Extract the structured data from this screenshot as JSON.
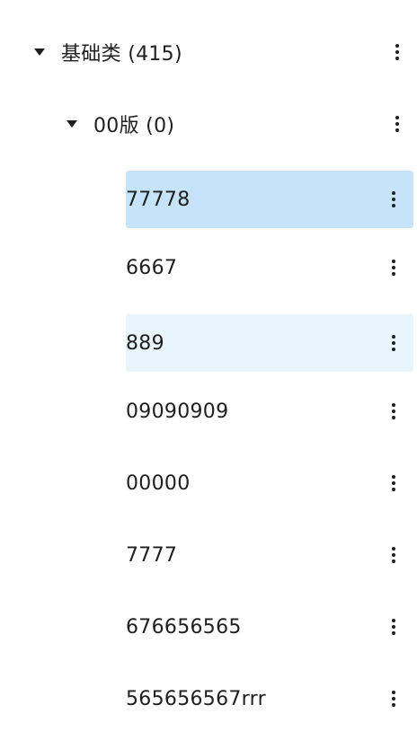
{
  "tree": {
    "category": {
      "label": "基础类 (415)"
    },
    "group": {
      "label": "00版 (0)"
    },
    "items": [
      {
        "label": "77778"
      },
      {
        "label": "6667"
      },
      {
        "label": "889"
      },
      {
        "label": "09090909"
      },
      {
        "label": "00000"
      },
      {
        "label": "7777"
      },
      {
        "label": "676656565"
      },
      {
        "label": "565656567rrr"
      }
    ]
  }
}
